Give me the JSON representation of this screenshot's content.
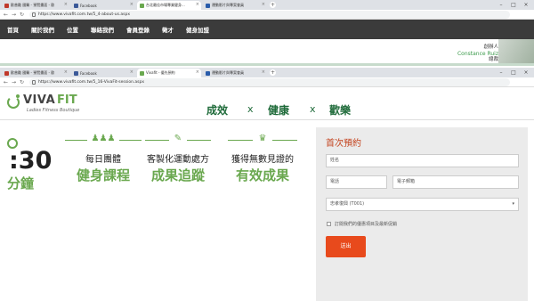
{
  "browser_top": {
    "tabs": [
      {
        "label": "歐普勵 國醫 - 預覽畫面 - 歐"
      },
      {
        "label": "Facebook"
      },
      {
        "label": "台北最佳市場專業健身..."
      },
      {
        "label": "運動影片與專案會員"
      }
    ],
    "url": "https://www.vivafit.com.tw/5_4-about-us.aspx"
  },
  "site_nav": [
    "首頁",
    "關於我們",
    "位置",
    "聯絡我們",
    "會員登錄",
    "徵才",
    "健身加盟"
  ],
  "contact": {
    "title": "創辦人",
    "name": "Constance Ruiz",
    "role": "總裁"
  },
  "browser_bottom": {
    "tabs": [
      {
        "label": "歐普勵 國醫 - 預覽畫面 - 歐"
      },
      {
        "label": "Facebook"
      },
      {
        "label": "Vivafit - 優先預約"
      },
      {
        "label": "運動影片與專案會員"
      }
    ],
    "url": "https://www.vivafit.com.tw/5_16-VivaFit-session.aspx"
  },
  "logo": {
    "viva": "VIVA",
    "fit": "FIT",
    "sub": "Ladies Fitness Boutique"
  },
  "slogan": {
    "a": "成效",
    "b": "健康",
    "c": "歡樂",
    "x": "x"
  },
  "features": {
    "minutes": ":30",
    "minutes_unit": "分鐘",
    "items": [
      {
        "l1": "每日團體",
        "l2": "健身課程",
        "icon": "people-icon"
      },
      {
        "l1": "客製化運動處方",
        "l2": "成果追蹤",
        "icon": "clipboard-icon"
      },
      {
        "l1": "獲得無數見證的",
        "l2": "有效成果",
        "icon": "trophy-icon"
      }
    ]
  },
  "form": {
    "title": "首次預約",
    "name_placeholder": "姓名",
    "phone_placeholder": "電話",
    "email_placeholder": "電子郵箱",
    "location_value": "忠孝復興 (T001)",
    "subscribe_label": "訂閱我們的優惠項目及最新促銷",
    "submit_label": "送出"
  },
  "colors": {
    "accent": "#6aa84f",
    "slogan": "#1f6b3a",
    "submit": "#e84a1c"
  }
}
